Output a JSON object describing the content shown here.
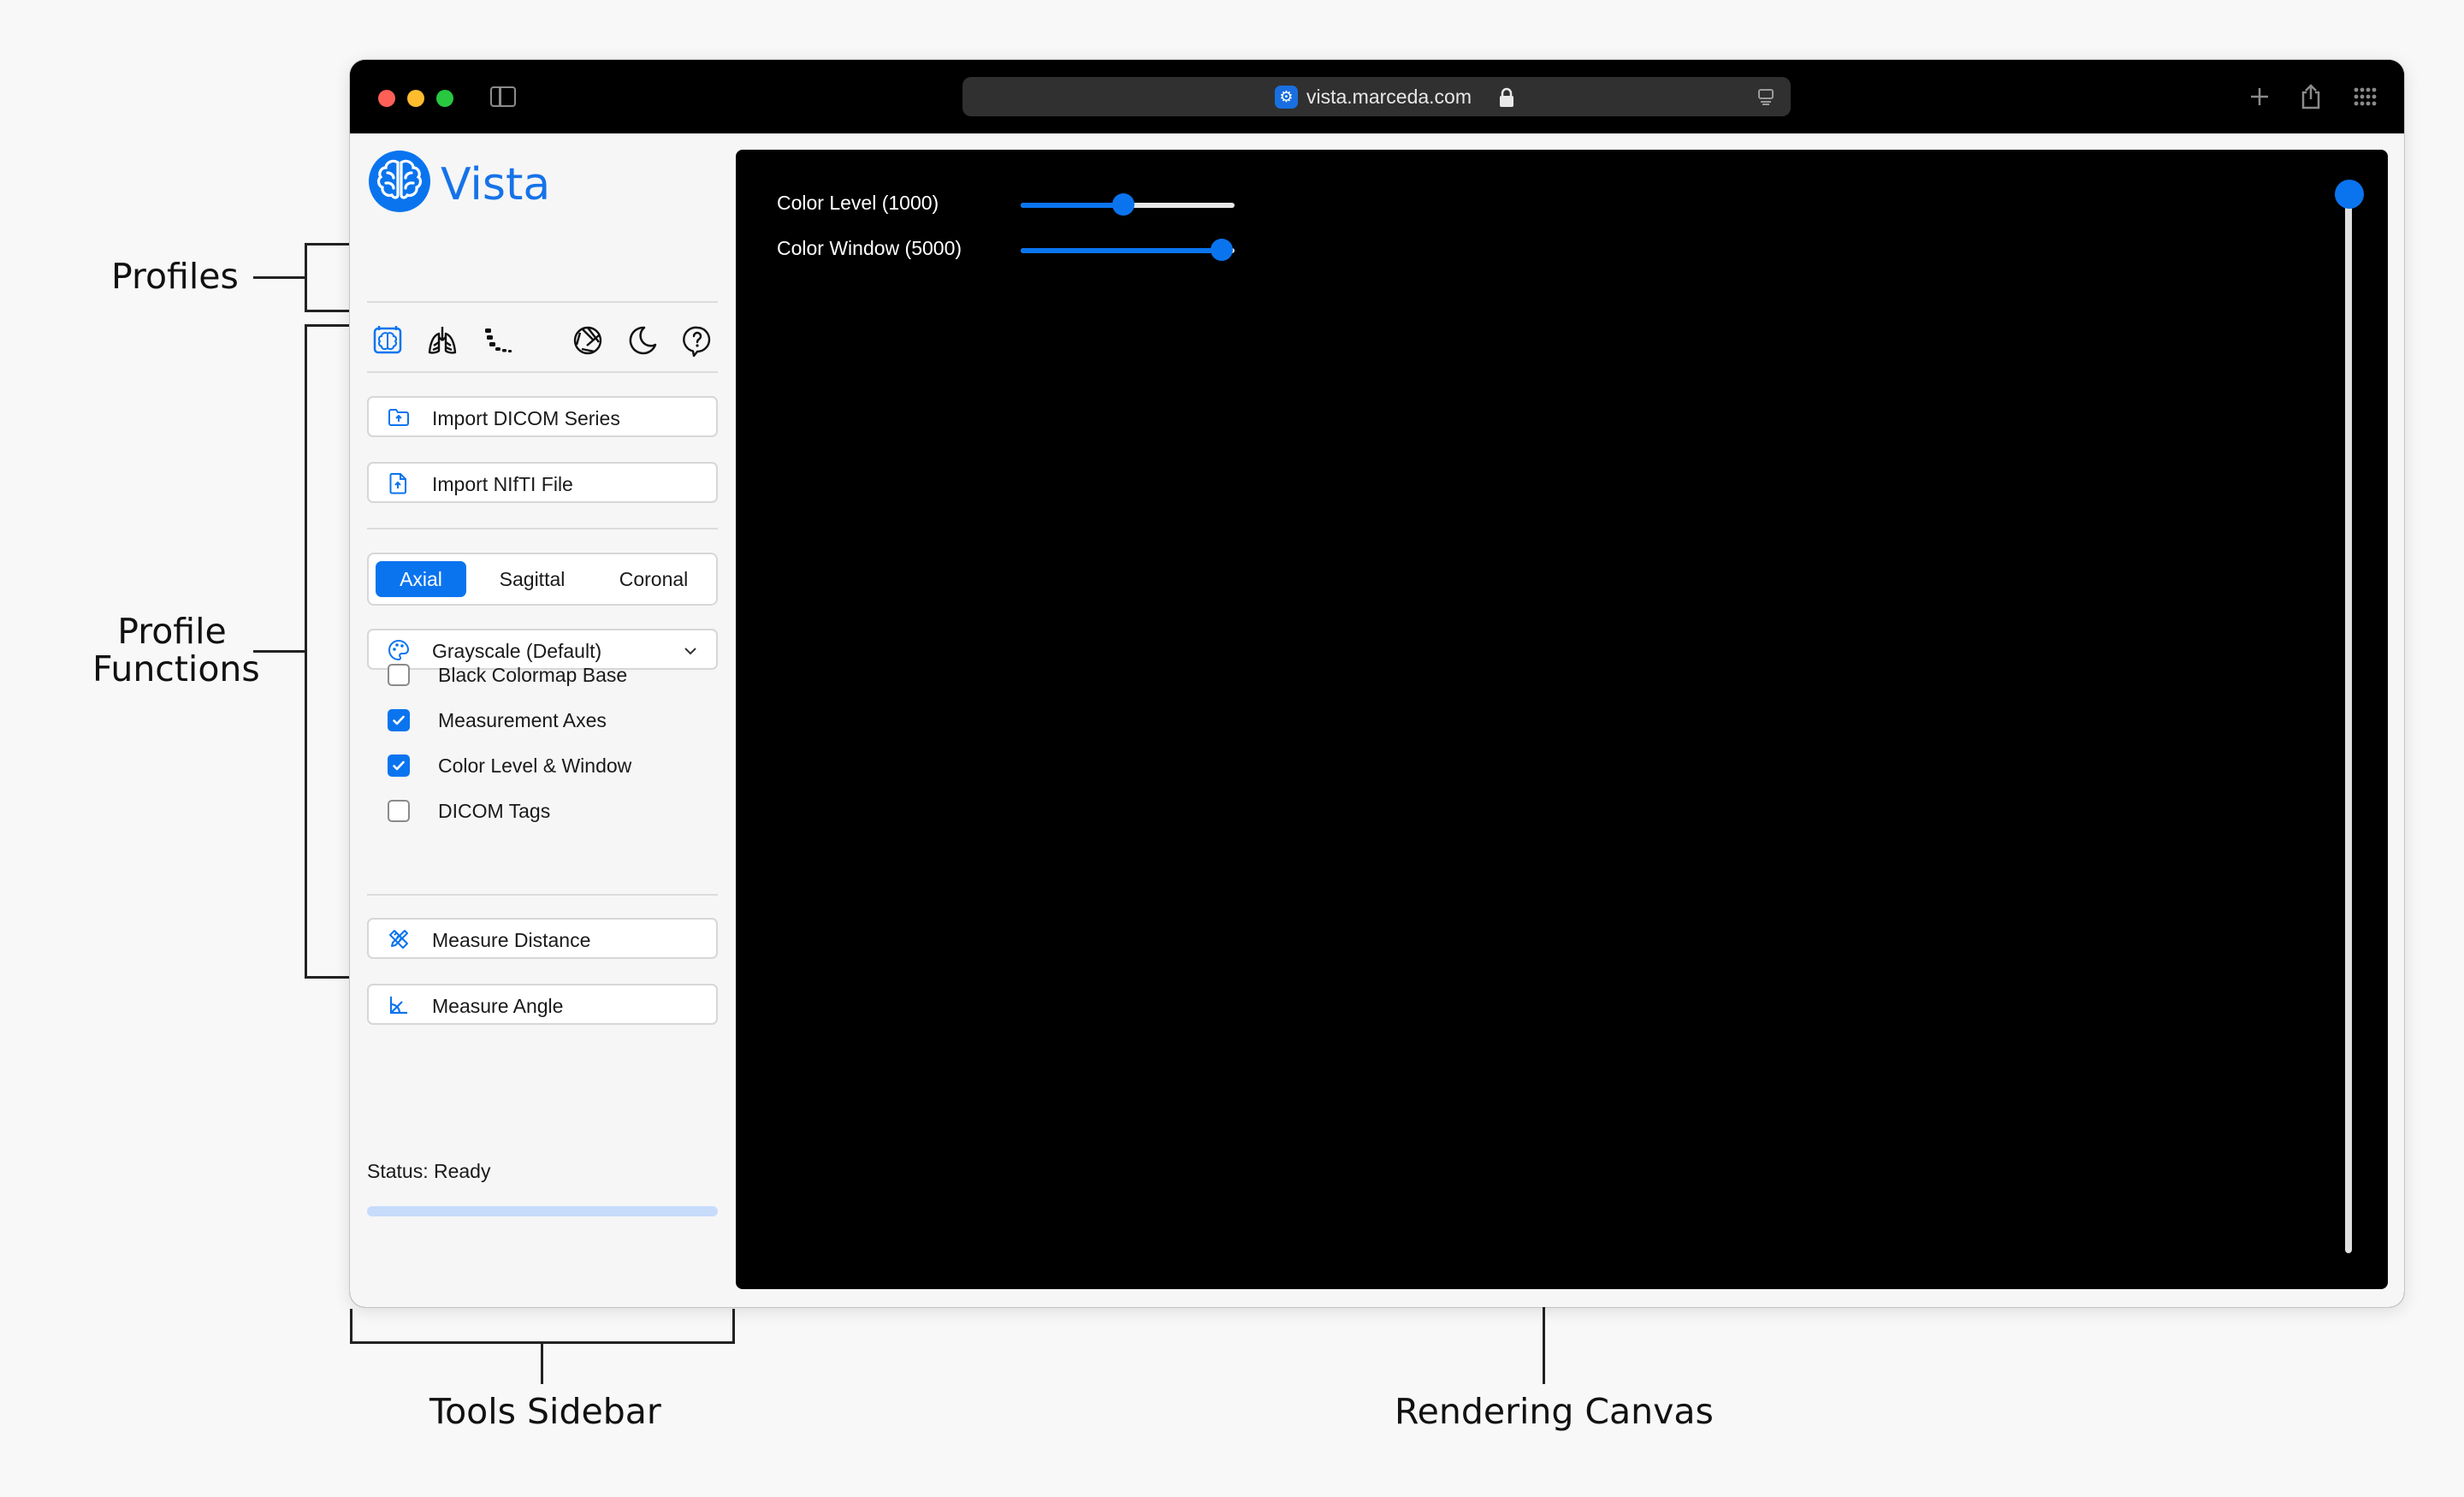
{
  "annotations": {
    "profiles": "Profiles",
    "profile_functions_line1": "Profile",
    "profile_functions_line2": "Functions",
    "tools_sidebar": "Tools Sidebar",
    "rendering_canvas": "Rendering Canvas"
  },
  "browser": {
    "url": "vista.marceda.com"
  },
  "app": {
    "brand": "Vista",
    "accent_color": "#0a74ef"
  },
  "profiles": [
    "brain-profile-icon",
    "lungs-profile-icon",
    "spine-profile-icon"
  ],
  "header_actions": [
    "aperture-icon",
    "moon-icon",
    "help-icon"
  ],
  "sidebar": {
    "import_dicom": "Import DICOM Series",
    "import_nifti": "Import NIfTI File",
    "views": [
      "Axial",
      "Sagittal",
      "Coronal"
    ],
    "active_view": "Axial",
    "colormap": "Grayscale (Default)",
    "checkboxes": [
      {
        "label": "Black Colormap Base",
        "checked": false
      },
      {
        "label": "Measurement Axes",
        "checked": true
      },
      {
        "label": "Color Level & Window",
        "checked": true
      },
      {
        "label": "DICOM Tags",
        "checked": false
      }
    ],
    "measure_distance": "Measure Distance",
    "measure_angle": "Measure Angle",
    "status": "Status: Ready",
    "progress_fraction": 0
  },
  "canvas": {
    "color_level_label": "Color Level (1000)",
    "color_level_fraction": 0.48,
    "color_window_label": "Color Window (5000)",
    "color_window_fraction": 0.94,
    "slice_fraction": 0
  }
}
